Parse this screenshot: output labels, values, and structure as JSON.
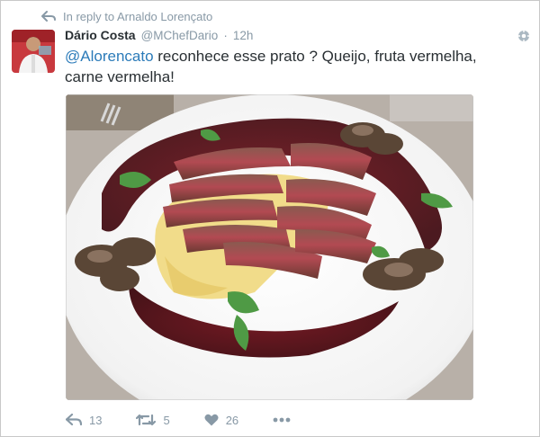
{
  "reply": {
    "icon": "reply-arrow-icon",
    "text": "In reply to Arnaldo Lorençato"
  },
  "author": {
    "name": "Dário Costa",
    "handle": "@MChefDario",
    "separator": "·",
    "time": "12h",
    "verified": true
  },
  "tweet": {
    "mention": "@Alorencato",
    "text": " reconhece esse prato ? Queijo, fruta vermelha, carne vermelha!"
  },
  "media": {
    "description_icon": "food-photo"
  },
  "actions": {
    "reply_count": "13",
    "retweet_count": "5",
    "like_count": "26"
  },
  "colors": {
    "muted": "#8899a6",
    "link": "#2b7bb9",
    "text": "#292f33",
    "verified": "#55acee"
  }
}
